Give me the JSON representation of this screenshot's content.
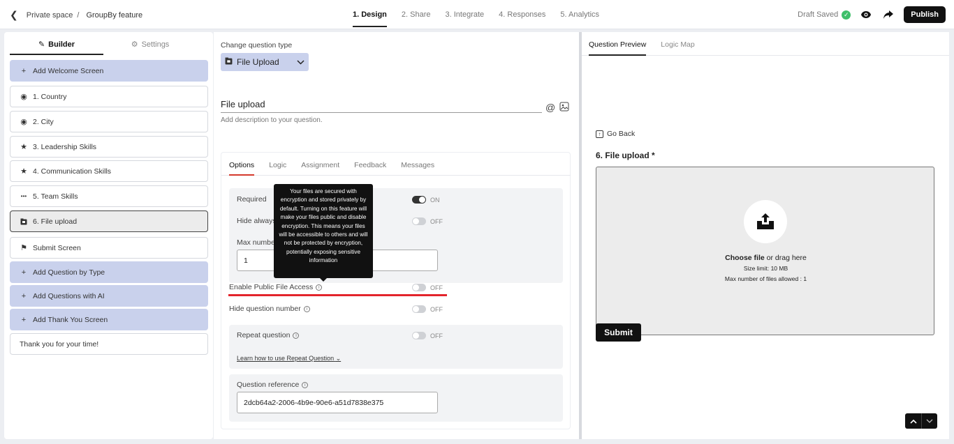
{
  "header": {
    "breadcrumb_parent": "Private space",
    "breadcrumb_sep": "/",
    "breadcrumb_current": "GroupBy feature",
    "steps": [
      "1. Design",
      "2. Share",
      "3. Integrate",
      "4. Responses",
      "5. Analytics"
    ],
    "draft_status": "Draft Saved",
    "publish_label": "Publish"
  },
  "sidebar": {
    "tabs": {
      "builder": "Builder",
      "settings": "Settings"
    },
    "add_welcome": "Add Welcome Screen",
    "questions": [
      {
        "label": "1. Country",
        "icon": "radio-icon"
      },
      {
        "label": "2. City",
        "icon": "radio-icon"
      },
      {
        "label": "3. Leadership Skills",
        "icon": "star-icon"
      },
      {
        "label": "4. Communication Skills",
        "icon": "star-icon"
      },
      {
        "label": "5. Team Skills",
        "icon": "dots-icon"
      },
      {
        "label": "6. File upload",
        "icon": "file-icon"
      }
    ],
    "submit_screen": "Submit Screen",
    "add_by_type": "Add Question by Type",
    "add_with_ai": "Add Questions with AI",
    "add_thank_you": "Add Thank You Screen",
    "thank_you": "Thank you for your time!"
  },
  "editor": {
    "change_type_label": "Change question type",
    "question_type": "File Upload",
    "question_title": "File upload",
    "description_placeholder": "Add description to your question.",
    "tabs": [
      "Options",
      "Logic",
      "Assignment",
      "Feedback",
      "Messages"
    ],
    "options": {
      "required_label": "Required",
      "required_state": "ON",
      "hide_always_label": "Hide always",
      "hide_always_state": "OFF",
      "max_number_label": "Max number",
      "max_number_value": "1",
      "public_access_label": "Enable Public File Access",
      "public_access_state": "OFF",
      "hide_number_label": "Hide question number",
      "hide_number_state": "OFF",
      "repeat_label": "Repeat question",
      "repeat_state": "OFF",
      "repeat_learn": "Learn how to use Repeat Question",
      "reference_label": "Question reference",
      "reference_value": "2dcb64a2-2006-4b9e-90e6-a51d7838e375"
    },
    "tooltip": "Your files are secured with encryption and stored privately by default. Turning on this feature will make your files public and disable encryption. This means your files will be accessible to others and will not be protected by encryption, potentially exposing sensitive information"
  },
  "preview": {
    "tabs": [
      "Question Preview",
      "Logic Map"
    ],
    "go_back": "Go Back",
    "question_title": "6. File upload *",
    "choose_file": "Choose file",
    "drag_text": " or drag here",
    "size_limit": "Size limit: 10 MB",
    "max_files": "Max number of files allowed : 1",
    "submit_label": "Submit"
  },
  "colors": {
    "accent_blue": "#c9d1ec",
    "highlight_red": "#e3242b",
    "success_green": "#3fbf6a"
  }
}
